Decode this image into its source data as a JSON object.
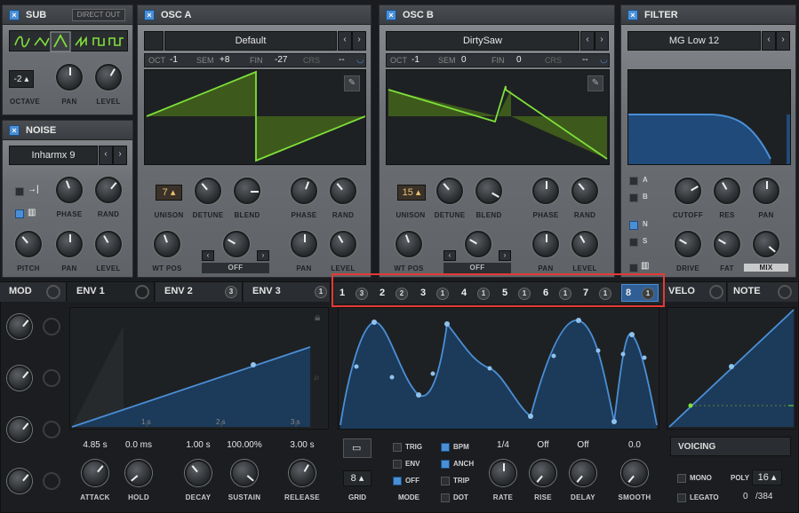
{
  "sub": {
    "title": "SUB",
    "direct_out": "DIRECT OUT",
    "octave": "-2",
    "labels": {
      "octave": "OCTAVE",
      "pan": "PAN",
      "level": "LEVEL"
    }
  },
  "noise": {
    "title": "NOISE",
    "preset": "Inharmx 9",
    "labels": {
      "phase": "PHASE",
      "rand": "RAND",
      "pitch": "PITCH",
      "pan": "PAN",
      "level": "LEVEL"
    }
  },
  "osc_a": {
    "title": "OSC A",
    "preset": "Default",
    "oct_label": "OCT",
    "oct": "-1",
    "sem_label": "SEM",
    "sem": "+8",
    "fin_label": "FIN",
    "fin": "-27",
    "crs_label": "CRS",
    "crs": "--",
    "unison": "7",
    "labels": {
      "unison": "UNISON",
      "detune": "DETUNE",
      "blend": "BLEND",
      "phase": "PHASE",
      "rand": "RAND",
      "wtpos": "WT POS",
      "off": "OFF",
      "pan": "PAN",
      "level": "LEVEL"
    }
  },
  "osc_b": {
    "title": "OSC B",
    "preset": "DirtySaw",
    "oct_label": "OCT",
    "oct": "-1",
    "sem_label": "SEM",
    "sem": "0",
    "fin_label": "FIN",
    "fin": "0",
    "crs_label": "CRS",
    "crs": "--",
    "unison": "15",
    "labels": {
      "unison": "UNISON",
      "detune": "DETUNE",
      "blend": "BLEND",
      "phase": "PHASE",
      "rand": "RAND",
      "wtpos": "WT POS",
      "off": "OFF",
      "pan": "PAN",
      "level": "LEVEL"
    }
  },
  "filter": {
    "title": "FILTER",
    "preset": "MG Low 12",
    "routes": [
      "A",
      "B",
      "N",
      "S"
    ],
    "labels": {
      "cutoff": "CUTOFF",
      "res": "RES",
      "pan": "PAN",
      "drive": "DRIVE",
      "fat": "FAT",
      "mix": "MIX"
    }
  },
  "tabs": {
    "mod": "MOD",
    "env1": "ENV 1",
    "env2": "ENV 2",
    "env2_badge": "3",
    "env3": "ENV 3",
    "env3_badge": "1",
    "velo": "VELO",
    "note": "NOTE"
  },
  "lfo_tabs": [
    {
      "n": "1",
      "b": "3"
    },
    {
      "n": "2",
      "b": "2"
    },
    {
      "n": "3",
      "b": "1"
    },
    {
      "n": "4",
      "b": "1"
    },
    {
      "n": "5",
      "b": "1"
    },
    {
      "n": "6",
      "b": "1"
    },
    {
      "n": "7",
      "b": "1"
    },
    {
      "n": "8",
      "b": "1"
    }
  ],
  "env": {
    "ticks": [
      "1 s",
      "2 s",
      "3 s"
    ],
    "attack": "4.85 s",
    "hold": "0.0 ms",
    "decay": "1.00 s",
    "sustain": "100.00%",
    "release": "3.00 s",
    "labels": {
      "attack": "ATTACK",
      "hold": "HOLD",
      "decay": "DECAY",
      "sustain": "SUSTAIN",
      "release": "RELEASE"
    }
  },
  "lfo": {
    "grid": "8",
    "grid_label": "GRID",
    "mode_label": "MODE",
    "trig": "TRIG",
    "env": "ENV",
    "off": "OFF",
    "bpm": "BPM",
    "anch": "ANCH",
    "trip": "TRIP",
    "dot": "DOT",
    "rate": "1/4",
    "rise": "Off",
    "delay": "Off",
    "smooth": "0.0",
    "labels": {
      "rate": "RATE",
      "rise": "RISE",
      "delay": "DELAY",
      "smooth": "SMOOTH"
    }
  },
  "voicing": {
    "title": "VOICING",
    "mono": "MONO",
    "legato": "LEGATO",
    "poly_label": "POLY",
    "poly": "16",
    "count": "0",
    "max": "/384"
  },
  "colors": {
    "accent": "#4a8fd6",
    "wave": "#7fe03a",
    "highlight": "#e53935"
  }
}
